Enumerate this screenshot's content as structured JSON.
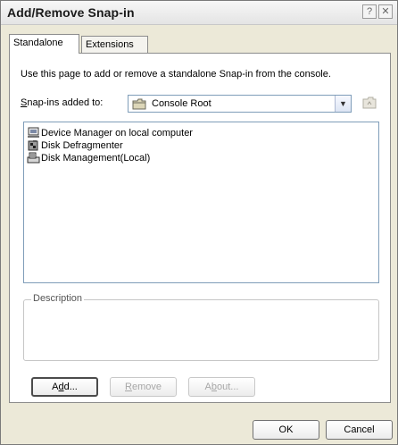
{
  "window": {
    "title": "Add/Remove Snap-in"
  },
  "title_buttons": {
    "help": "?",
    "close": "✕"
  },
  "tabs": [
    {
      "label": "Standalone",
      "active": true
    },
    {
      "label": "Extensions",
      "active": false
    }
  ],
  "instruction": "Use this page to add or remove a standalone Snap-in from the console.",
  "snapins_added_to": {
    "label_accel": "S",
    "label_rest": "nap-ins added to:",
    "value": "Console Root",
    "icon": "folder-icon",
    "arrow": "▼"
  },
  "snapins": [
    {
      "name": "Device Manager on local computer",
      "icon": "device-manager-icon"
    },
    {
      "name": "Disk Defragmenter",
      "icon": "disk-defragmenter-icon"
    },
    {
      "name": "Disk Management(Local)",
      "icon": "disk-management-icon"
    }
  ],
  "description": {
    "legend": "Description"
  },
  "buttons": {
    "add_pre": "A",
    "add_accel": "d",
    "add_post": "d...",
    "remove_accel": "R",
    "remove_post": "emove",
    "about_pre": "A",
    "about_accel": "b",
    "about_post": "out...",
    "ok": "OK",
    "cancel": "Cancel"
  },
  "colors": {
    "dialog_bg": "#ece9d8",
    "panel_bg": "#ffffff",
    "disabled_text": "#a7a7a7"
  }
}
